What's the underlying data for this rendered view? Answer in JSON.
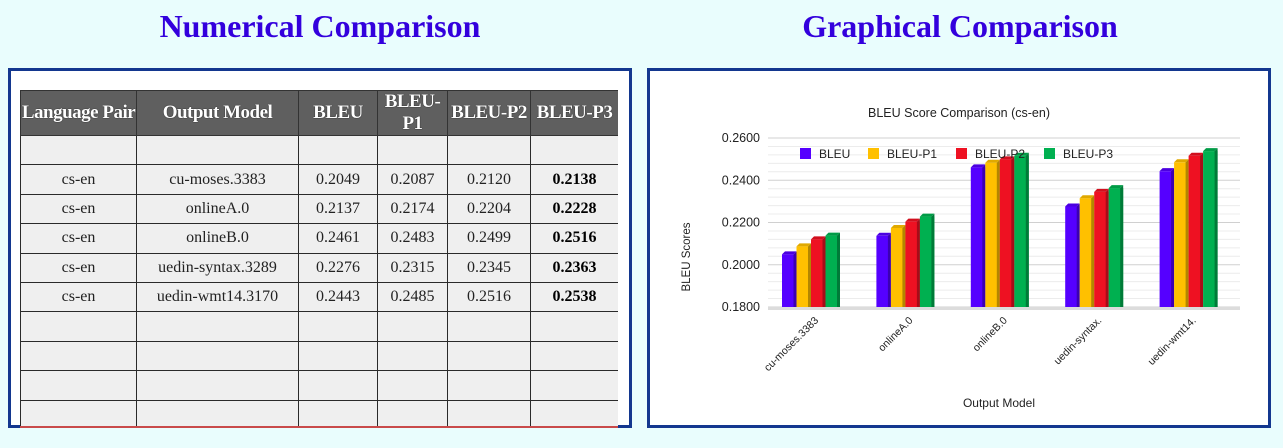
{
  "headings": {
    "left": "Numerical Comparison",
    "right": "Graphical Comparison"
  },
  "table": {
    "columns": [
      "Language Pair",
      "Output Model",
      "BLEU",
      "BLEU-P1",
      "BLEU-P2",
      "BLEU-P3"
    ],
    "rows": [
      [
        "cs-en",
        "cu-moses.3383",
        "0.2049",
        "0.2087",
        "0.2120",
        "0.2138"
      ],
      [
        "cs-en",
        "onlineA.0",
        "0.2137",
        "0.2174",
        "0.2204",
        "0.2228"
      ],
      [
        "cs-en",
        "onlineB.0",
        "0.2461",
        "0.2483",
        "0.2499",
        "0.2516"
      ],
      [
        "cs-en",
        "uedin-syntax.3289",
        "0.2276",
        "0.2315",
        "0.2345",
        "0.2363"
      ],
      [
        "cs-en",
        "uedin-wmt14.3170",
        "0.2443",
        "0.2485",
        "0.2516",
        "0.2538"
      ]
    ],
    "empty_rows_before": 1,
    "empty_rows_after": 5
  },
  "chart_data": {
    "type": "bar",
    "title": "BLEU Score Comparison (cs-en)",
    "xlabel": "Output Model",
    "ylabel": "BLEU Scores",
    "categories": [
      "cu-moses.3383",
      "onlineA.0",
      "onlineB.0",
      "uedin-syntax.",
      "uedin-wmt14."
    ],
    "series": [
      {
        "name": "BLEU",
        "color": "#5500ff",
        "values": [
          0.2049,
          0.2137,
          0.2461,
          0.2276,
          0.2443
        ]
      },
      {
        "name": "BLEU-P1",
        "color": "#ffc000",
        "values": [
          0.2087,
          0.2174,
          0.2483,
          0.2315,
          0.2485
        ]
      },
      {
        "name": "BLEU-P2",
        "color": "#ee1122",
        "values": [
          0.212,
          0.2204,
          0.2499,
          0.2345,
          0.2516
        ]
      },
      {
        "name": "BLEU-P3",
        "color": "#00b050",
        "values": [
          0.2138,
          0.2228,
          0.2516,
          0.2363,
          0.2538
        ]
      }
    ],
    "ylim": [
      0.18,
      0.26
    ],
    "yticks": [
      "0.1800",
      "0.2000",
      "0.2200",
      "0.2400",
      "0.2600"
    ],
    "grid": true,
    "legend_position": "top-left"
  }
}
